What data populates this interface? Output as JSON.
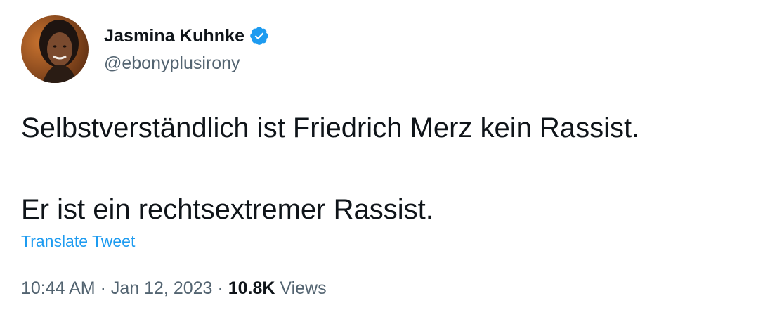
{
  "author": {
    "display_name": "Jasmina Kuhnke",
    "handle": "@ebonyplusirony",
    "verified": true,
    "verified_color": "#1d9bf0"
  },
  "tweet": {
    "lines": [
      "Selbstverständlich ist Friedrich Merz kein Rassist.",
      "Er ist ein rechtsextremer Rassist."
    ],
    "translate_label": "Translate Tweet",
    "time": "10:44 AM",
    "separator": "·",
    "date": "Jan 12, 2023",
    "views_count": "10.8K",
    "views_label": "Views"
  },
  "colors": {
    "text": "#0f1419",
    "secondary": "#536471",
    "link": "#1d9bf0"
  }
}
